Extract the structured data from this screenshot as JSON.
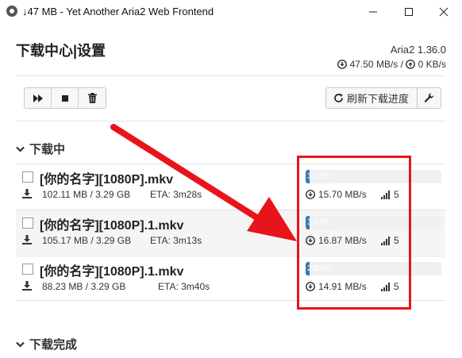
{
  "window": {
    "title": "↓47 MB - Yet Another Aria2 Web Frontend",
    "icon": "aria2-logo-icon"
  },
  "header": {
    "title": "下载中心|设置",
    "version": "Aria2 1.36.0",
    "download_speed": "47.50 MB/s",
    "separator": " / ",
    "upload_speed": "0 KB/s"
  },
  "toolbar": {
    "buttons": [
      "forward-icon",
      "stop-icon",
      "trash-icon"
    ],
    "refresh_label": "刷新下载进度",
    "settings_icon": "wrench-icon"
  },
  "sections": {
    "downloading": "下载中",
    "completed": "下载完成"
  },
  "tasks": [
    {
      "name": "[你的名字][1080P].mkv",
      "size": "102.11 MB / 3.29 GB",
      "eta": "ETA: 3m28s",
      "progress": 0.0303,
      "speed": "15.70 MB/s",
      "connections": "5"
    },
    {
      "name": "[你的名字][1080P].1.mkv",
      "size": "105.17 MB / 3.29 GB",
      "eta": "ETA: 3m13s",
      "progress": 0.0312,
      "speed": "16.87 MB/s",
      "connections": "5"
    },
    {
      "name": "[你的名字][1080P].1.mkv",
      "size": "88.23 MB / 3.29 GB",
      "eta": "ETA: 3m40s",
      "progress": 0.0262,
      "speed": "14.91 MB/s",
      "connections": "5"
    }
  ],
  "colors": {
    "accent": "#337ab7",
    "highlight": "#e8141b"
  }
}
